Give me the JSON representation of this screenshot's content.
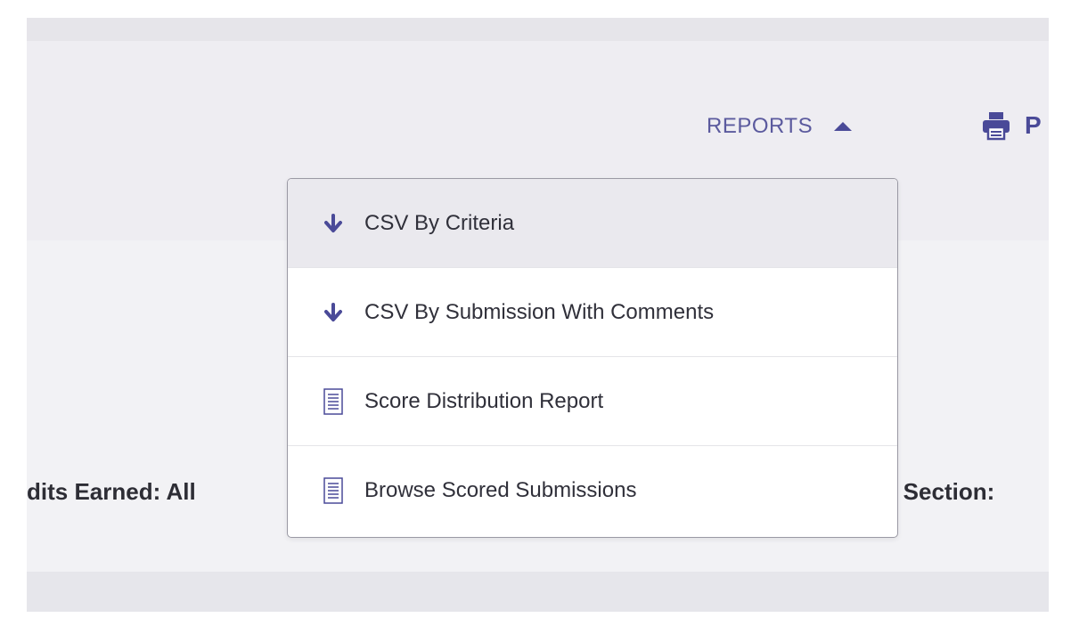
{
  "header": {
    "reports_label": "REPORTS",
    "print_label": "P",
    "caret_icon": "caret-up-icon",
    "printer_icon": "printer-icon"
  },
  "filters": {
    "credits_earned": "dits Earned: All",
    "section": "e Section:"
  },
  "dropdown": {
    "items": [
      {
        "label": "CSV By Criteria",
        "icon": "arrow-down-icon"
      },
      {
        "label": "CSV By Submission With Comments",
        "icon": "arrow-down-icon"
      },
      {
        "label": "Score Distribution Report",
        "icon": "document-icon"
      },
      {
        "label": "Browse Scored Submissions",
        "icon": "document-icon"
      }
    ]
  },
  "colors": {
    "accent": "#4a4a98",
    "header_bg": "#eeedf2",
    "panel_bg": "#f2f2f5",
    "active_item_bg": "#eae9ee"
  }
}
